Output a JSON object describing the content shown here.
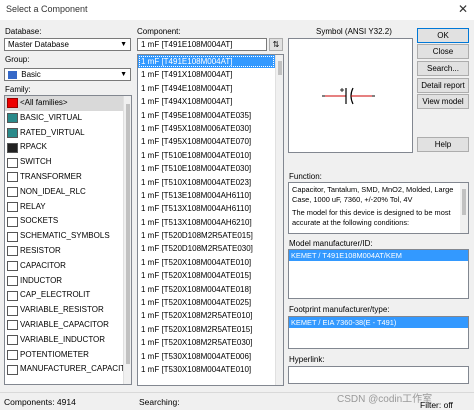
{
  "window": {
    "title": "Select a Component",
    "close_glyph": "✕"
  },
  "database": {
    "label": "Database:",
    "value": "Master Database"
  },
  "group": {
    "label": "Group:",
    "value": "Basic"
  },
  "family": {
    "label": "Family:",
    "items": [
      {
        "label": "<All families>",
        "icon": "all-families-icon",
        "selected": true
      },
      {
        "label": "BASIC_VIRTUAL",
        "icon": "basic-virtual-icon"
      },
      {
        "label": "RATED_VIRTUAL",
        "icon": "rated-virtual-icon"
      },
      {
        "label": "RPACK",
        "icon": "rpack-icon"
      },
      {
        "label": "SWITCH",
        "icon": "switch-icon"
      },
      {
        "label": "TRANSFORMER",
        "icon": "transformer-icon"
      },
      {
        "label": "NON_IDEAL_RLC",
        "icon": "non-ideal-rlc-icon"
      },
      {
        "label": "RELAY",
        "icon": "relay-icon"
      },
      {
        "label": "SOCKETS",
        "icon": "sockets-icon"
      },
      {
        "label": "SCHEMATIC_SYMBOLS",
        "icon": "schematic-symbols-icon"
      },
      {
        "label": "RESISTOR",
        "icon": "resistor-icon"
      },
      {
        "label": "CAPACITOR",
        "icon": "capacitor-icon"
      },
      {
        "label": "INDUCTOR",
        "icon": "inductor-icon"
      },
      {
        "label": "CAP_ELECTROLIT",
        "icon": "cap-electrolit-icon"
      },
      {
        "label": "VARIABLE_RESISTOR",
        "icon": "variable-resistor-icon"
      },
      {
        "label": "VARIABLE_CAPACITOR",
        "icon": "variable-capacitor-icon"
      },
      {
        "label": "VARIABLE_INDUCTOR",
        "icon": "variable-inductor-icon"
      },
      {
        "label": "POTENTIOMETER",
        "icon": "potentiometer-icon"
      },
      {
        "label": "MANUFACTURER_CAPACIT",
        "icon": "manufacturer-capacitor-icon"
      }
    ]
  },
  "component": {
    "label": "Component:",
    "value": "1 mF  [T491E108M004AT]",
    "items": [
      "1 mF  [T491E108M004AT]",
      "1 mF  [T491X108M004AT]",
      "1 mF  [T494E108M004AT]",
      "1 mF  [T494X108M004AT]",
      "1 mF  [T495E108M004ATE035]",
      "1 mF  [T495X108M006ATE030]",
      "1 mF  [T495X108M004ATE070]",
      "1 mF  [T510E108M004ATE010]",
      "1 mF  [T510E108M004ATE030]",
      "1 mF  [T510X108M004ATE023]",
      "1 mF  [T513E108M004AH6110]",
      "1 mF  [T513X108M004AH6110]",
      "1 mF  [T513X108M004AH6210]",
      "1 mF  [T520D108M2R5ATE015]",
      "1 mF  [T520D108M2R5ATE030]",
      "1 mF  [T520X108M004ATE010]",
      "1 mF  [T520X108M004ATE015]",
      "1 mF  [T520X108M004ATE018]",
      "1 mF  [T520X108M004ATE025]",
      "1 mF  [T520X108M2R5ATE010]",
      "1 mF  [T520X108M2R5ATE015]",
      "1 mF  [T520X108M2R5ATE030]",
      "1 mF  [T530X108M004ATE006]",
      "1 mF  [T530X108M004ATE010]"
    ]
  },
  "symbol": {
    "label": "Symbol (ANSI Y32.2)"
  },
  "buttons": {
    "ok": "OK",
    "close": "Close",
    "search": "Search...",
    "detail_report": "Detail report",
    "view_model": "View model",
    "help": "Help"
  },
  "function": {
    "label": "Function:",
    "text1": "Capacitor, Tantalum, SMD, MnO2, Molded, Large Case, 1000 uF, 7360, +/-20% Tol, 4V",
    "text2": "The model for this device is designed to be most accurate at the following conditions:"
  },
  "model_mfr": {
    "label": "Model manufacturer/ID:",
    "value": "KEMET / T491E108M004AT/KEM"
  },
  "footprint_mfr": {
    "label": "Footprint manufacturer/type:",
    "value": "KEMET / EIA 7360-38(E - T491)"
  },
  "hyperlink": {
    "label": "Hyperlink:"
  },
  "status": {
    "components": "Components: 4914",
    "searching": "Searching:",
    "filter": "Filter: off",
    "watermark": "CSDN @codin工作室"
  }
}
